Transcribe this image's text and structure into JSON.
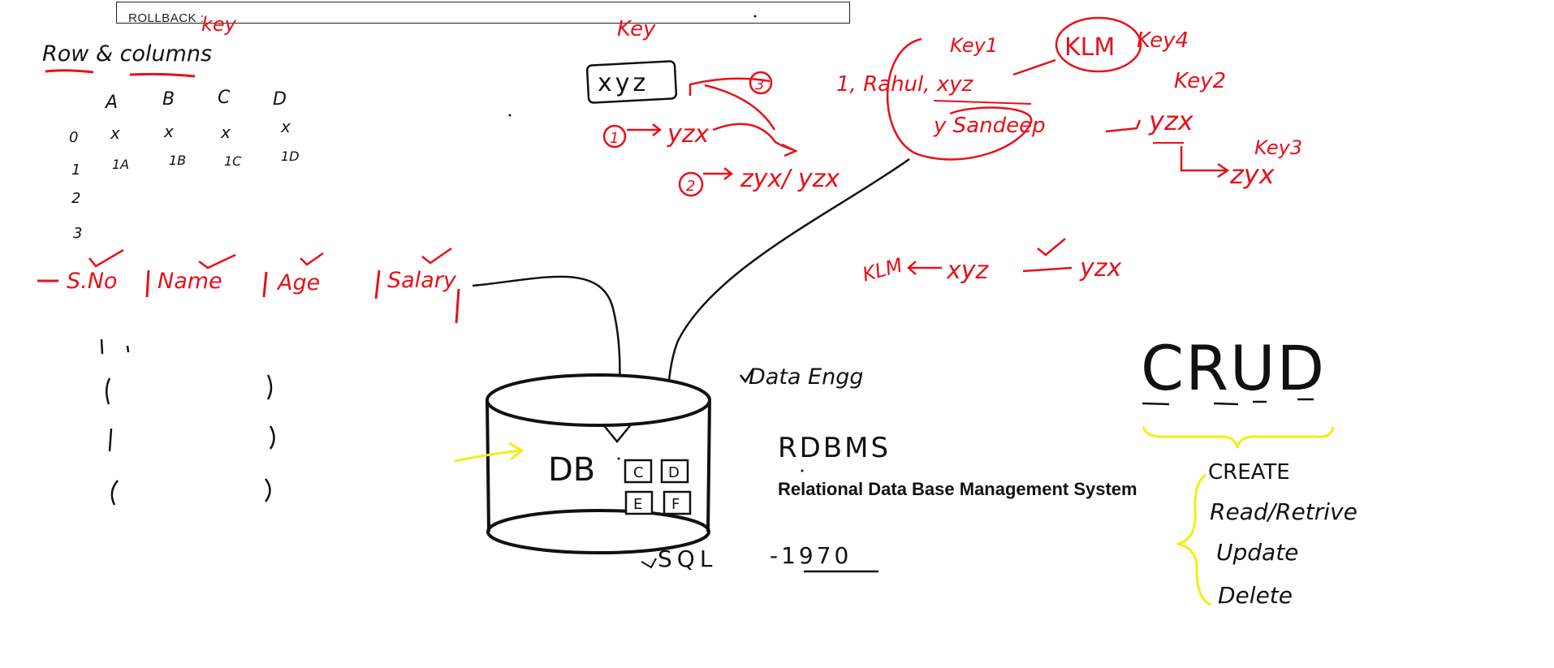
{
  "top_bar": {
    "label": "ROLLBACK :"
  },
  "colors": {
    "red": "#e8101a",
    "black": "#111111",
    "yellow": "#f3ee14"
  },
  "left_notes": {
    "heading": "Row & columns",
    "heading_key": "key",
    "grid": {
      "columns": [
        "A",
        "B",
        "C",
        "D"
      ],
      "rows": [
        "0",
        "1",
        "2",
        "3"
      ],
      "row0": [
        "x",
        "x",
        "x",
        "x"
      ],
      "row1": [
        "1A",
        "1B",
        "1C",
        "1D"
      ]
    },
    "fields": [
      "S.No",
      "Name",
      "Age",
      "Salary"
    ]
  },
  "key_notes": {
    "key_label": "Key",
    "xyz_box": "xyz",
    "circle_1": "1",
    "circle_2": "2",
    "circle_3": "3",
    "yzx": "yzx",
    "zyx_yzx": "zyx/ yzx"
  },
  "rows_notes": {
    "rahul_line": "1, Rahul, xyz",
    "key1": "Key1",
    "klm": "KLM",
    "key4": "Key4",
    "key2": "Key2",
    "sandeep_line": "y Sandeep",
    "yzx2": "yzx",
    "key3": "Key3",
    "zyx": "zyx",
    "klm_line": "KLM",
    "xyz2": "xyz",
    "yzx3": "yzx"
  },
  "database": {
    "db_label": "DB",
    "tables": [
      "C",
      "D",
      "E",
      "F"
    ],
    "data_engg": "Data Engg",
    "rdbms": "RDBMS",
    "rdbms_full": "Relational Data Base Management System",
    "sql": "SQL",
    "year": "-1970"
  },
  "crud": {
    "title": "CRUD",
    "ops": [
      "CREATE",
      "Read/Retrive",
      "Update",
      "Delete"
    ]
  }
}
